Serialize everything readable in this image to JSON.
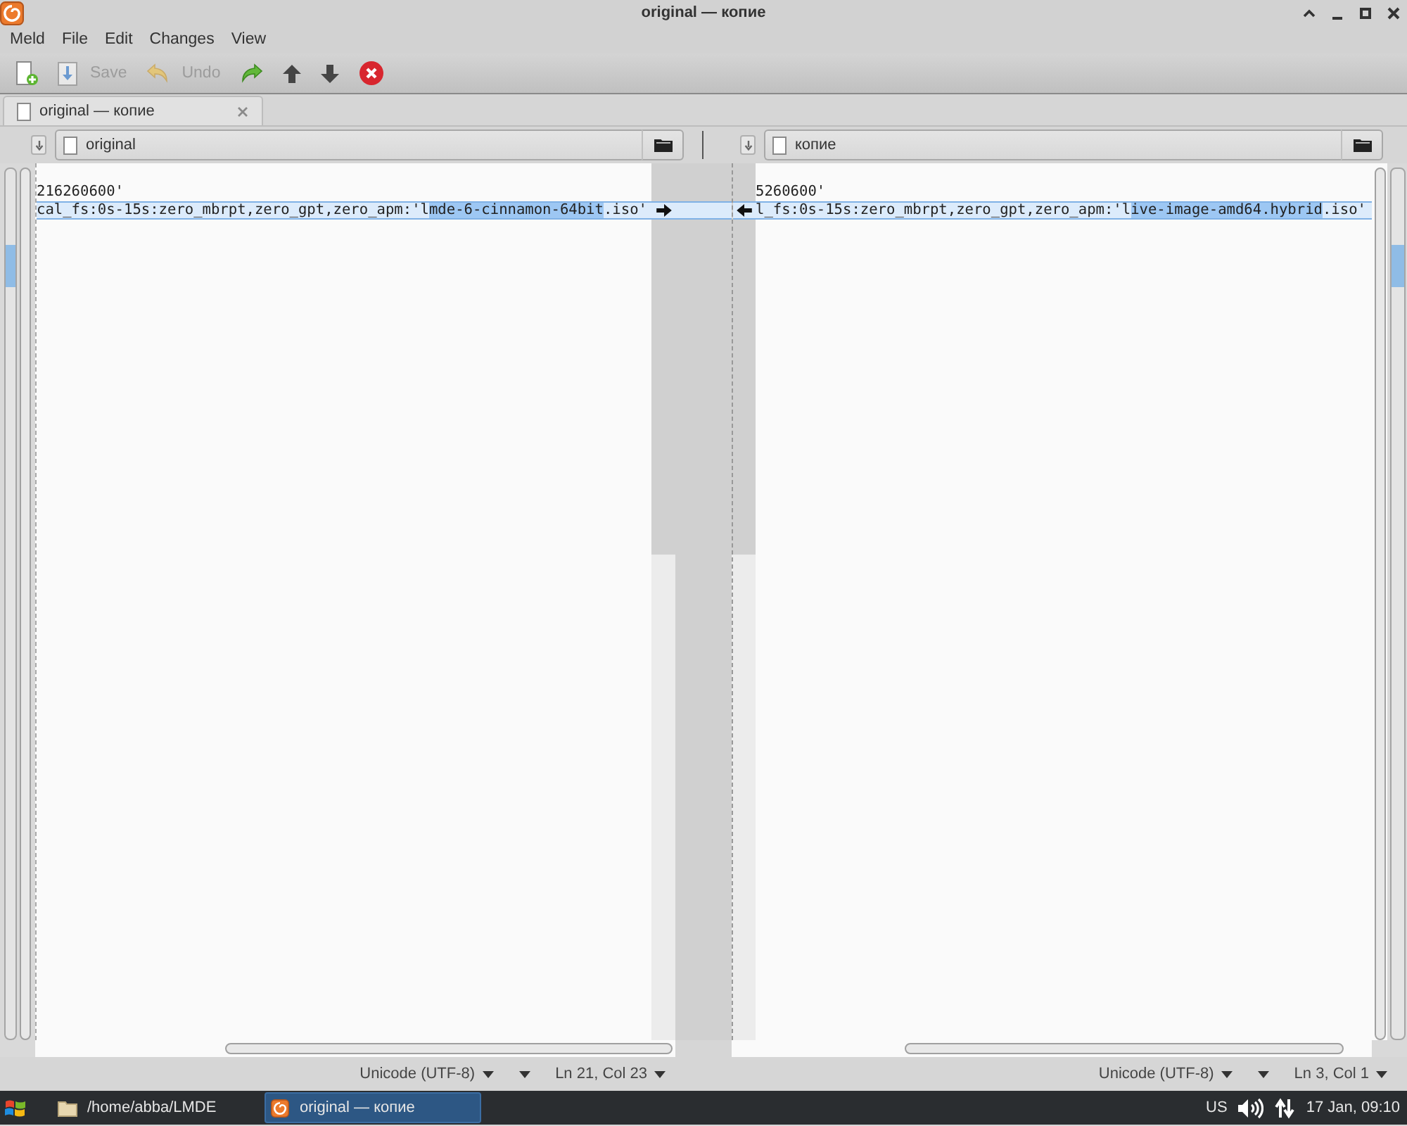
{
  "window": {
    "title": "original — копие"
  },
  "menu": [
    {
      "label": "Meld"
    },
    {
      "label": "File"
    },
    {
      "label": "Edit"
    },
    {
      "label": "Changes"
    },
    {
      "label": "View"
    }
  ],
  "toolbar": [
    {
      "kind": "new",
      "disabled": false
    },
    {
      "kind": "save",
      "label": "Save",
      "disabled": true
    },
    {
      "kind": "undo",
      "label": "Undo",
      "disabled": true
    },
    {
      "kind": "redo",
      "disabled": false
    },
    {
      "kind": "up",
      "disabled": false
    },
    {
      "kind": "down",
      "disabled": false
    },
    {
      "kind": "stop",
      "disabled": false
    }
  ],
  "tabs": [
    {
      "label": "original — копие",
      "selected": true
    }
  ],
  "panes": [
    {
      "file": "original",
      "lines": [
        {
          "changed": false,
          "segments": [
            {
              "text": "216260600'",
              "changed": false
            }
          ]
        },
        {
          "changed": true,
          "segments": [
            {
              "text": "cal_fs:0s-15s:zero_mbrpt,zero_gpt,zero_apm:'l",
              "changed": false
            },
            {
              "text": "mde-6-cinnamon-64bit",
              "changed": true
            },
            {
              "text": ".iso'",
              "changed": false
            }
          ]
        }
      ],
      "encoding": "Unicode (UTF-8)",
      "position": "Ln 21, Col 23"
    },
    {
      "file": "копие",
      "lines": [
        {
          "changed": false,
          "segments": [
            {
              "text": "5260600'",
              "changed": false
            }
          ]
        },
        {
          "changed": true,
          "segments": [
            {
              "text": "l_fs:0s-15s:zero_mbrpt,zero_gpt,zero_apm:'l",
              "changed": false
            },
            {
              "text": "ive-image-amd64.hybrid",
              "changed": true
            },
            {
              "text": ".iso'",
              "changed": false
            }
          ]
        }
      ],
      "encoding": "Unicode (UTF-8)",
      "position": "Ln 3, Col 1"
    }
  ],
  "taskbar": {
    "tasks": [
      {
        "kind": "folder",
        "label": "/home/abba/LMDE",
        "selected": false
      },
      {
        "kind": "app",
        "label": "original — копие",
        "selected": true
      }
    ],
    "tray": {
      "layout": "US",
      "clock": "17 Jan, 09:10"
    }
  }
}
